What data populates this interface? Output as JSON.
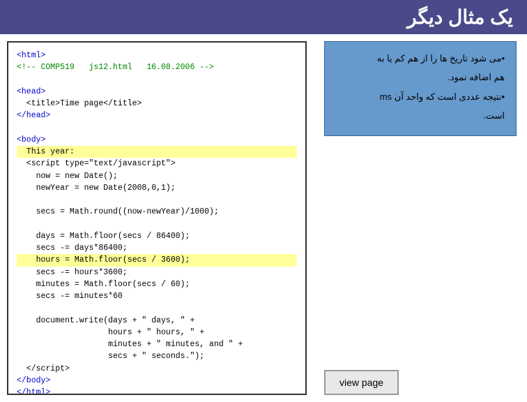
{
  "header": {
    "title": "یک مثال دیگر"
  },
  "code": {
    "comment_line": "<!-- COMP519   js12.html   16.08.2006 -->",
    "html_open": "<html>",
    "head_open": "<head>",
    "title_tag": "  <title>Time page</title>",
    "head_close": "</head>",
    "body_open": "<body>",
    "this_year": "  This year:",
    "script_open": "  <script type=\"text/javascript\">",
    "line1": "    now = new Date();",
    "line2": "    newYear = new Date(2008,0,1);",
    "blank1": "",
    "line3": "    secs = Math.round((now-newYear)/1000);",
    "blank2": "",
    "line4": "    days = Math.floor(secs / 86400);",
    "line5": "    secs -= days*86400;",
    "line6": "    hours = Math.floor(secs / 3600);",
    "line7": "    secs -= hours*3600;",
    "line8": "    minutes = Math.floor(secs / 60);",
    "line9": "    secs -= minutes*60",
    "blank3": "",
    "line10": "    document.write(days + \" days, \" +",
    "line11": "                   hours + \" hours, \" +",
    "line12": "                   minutes + \" minutes, and \" +",
    "line13": "                   secs + \" seconds.\");",
    "script_close": "  </script>",
    "body_close": "</body>",
    "html_close": "</html>"
  },
  "info": {
    "bullet1": "•می شود تاریخ ها را از هم کم یا به",
    "bullet1b": "هم اضافه نمود.",
    "bullet2": "•نتیجه عددی است که واحد آن ms",
    "bullet2b": "است."
  },
  "view_button": {
    "label": "view page"
  }
}
